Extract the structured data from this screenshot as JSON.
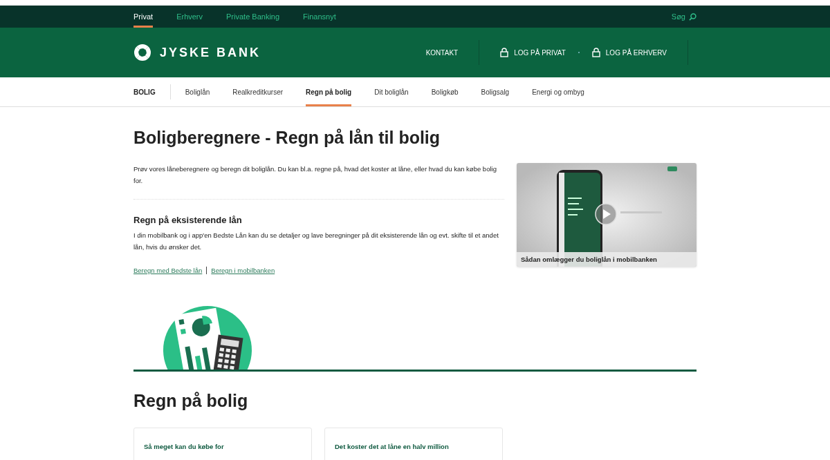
{
  "top_nav": {
    "items": [
      {
        "label": "Privat",
        "selected": true
      },
      {
        "label": "Erhverv",
        "selected": false
      },
      {
        "label": "Private Banking",
        "selected": false
      },
      {
        "label": "Finansnyt",
        "selected": false
      }
    ],
    "search": "Søg"
  },
  "header": {
    "logo": "JYSKE BANK",
    "contact": "KONTAKT",
    "logins": [
      "LOG PÅ PRIVAT",
      "LOG PÅ ERHVERV"
    ]
  },
  "sub_nav": {
    "section": "BOLIG",
    "items": [
      {
        "label": "Boliglån",
        "selected": false
      },
      {
        "label": "Realkreditkurser",
        "selected": false
      },
      {
        "label": "Regn på bolig",
        "selected": true
      },
      {
        "label": "Dit boliglån",
        "selected": false
      },
      {
        "label": "Boligkøb",
        "selected": false
      },
      {
        "label": "Boligsalg",
        "selected": false
      },
      {
        "label": "Energi og ombyg",
        "selected": false
      }
    ]
  },
  "page_title": "Boligberegnere - Regn på lån til bolig",
  "intro": "Prøv vores låneberegnere og beregn dit boliglån. Du kan bl.a. regne på, hvad det koster at låne, eller hvad du kan købe bolig for.",
  "existing": {
    "heading": "Regn på eksisterende lån",
    "text": "I din mobilbank og i app'en Bedste Lån kan du se detaljer og lave beregninger på dit eksisterende lån og evt. skifte til et andet lån, hvis du ønsker det.",
    "links": [
      "Beregn med Bedste lån",
      "Beregn i mobilbanken"
    ]
  },
  "video": {
    "kind": "picture",
    "caption": "Sådan omlægger du boliglån i mobilbanken"
  },
  "section_title": "Regn på bolig",
  "cards": [
    {
      "title": "Så meget kan du købe for"
    },
    {
      "title": "Det koster det at låne en halv million"
    }
  ]
}
